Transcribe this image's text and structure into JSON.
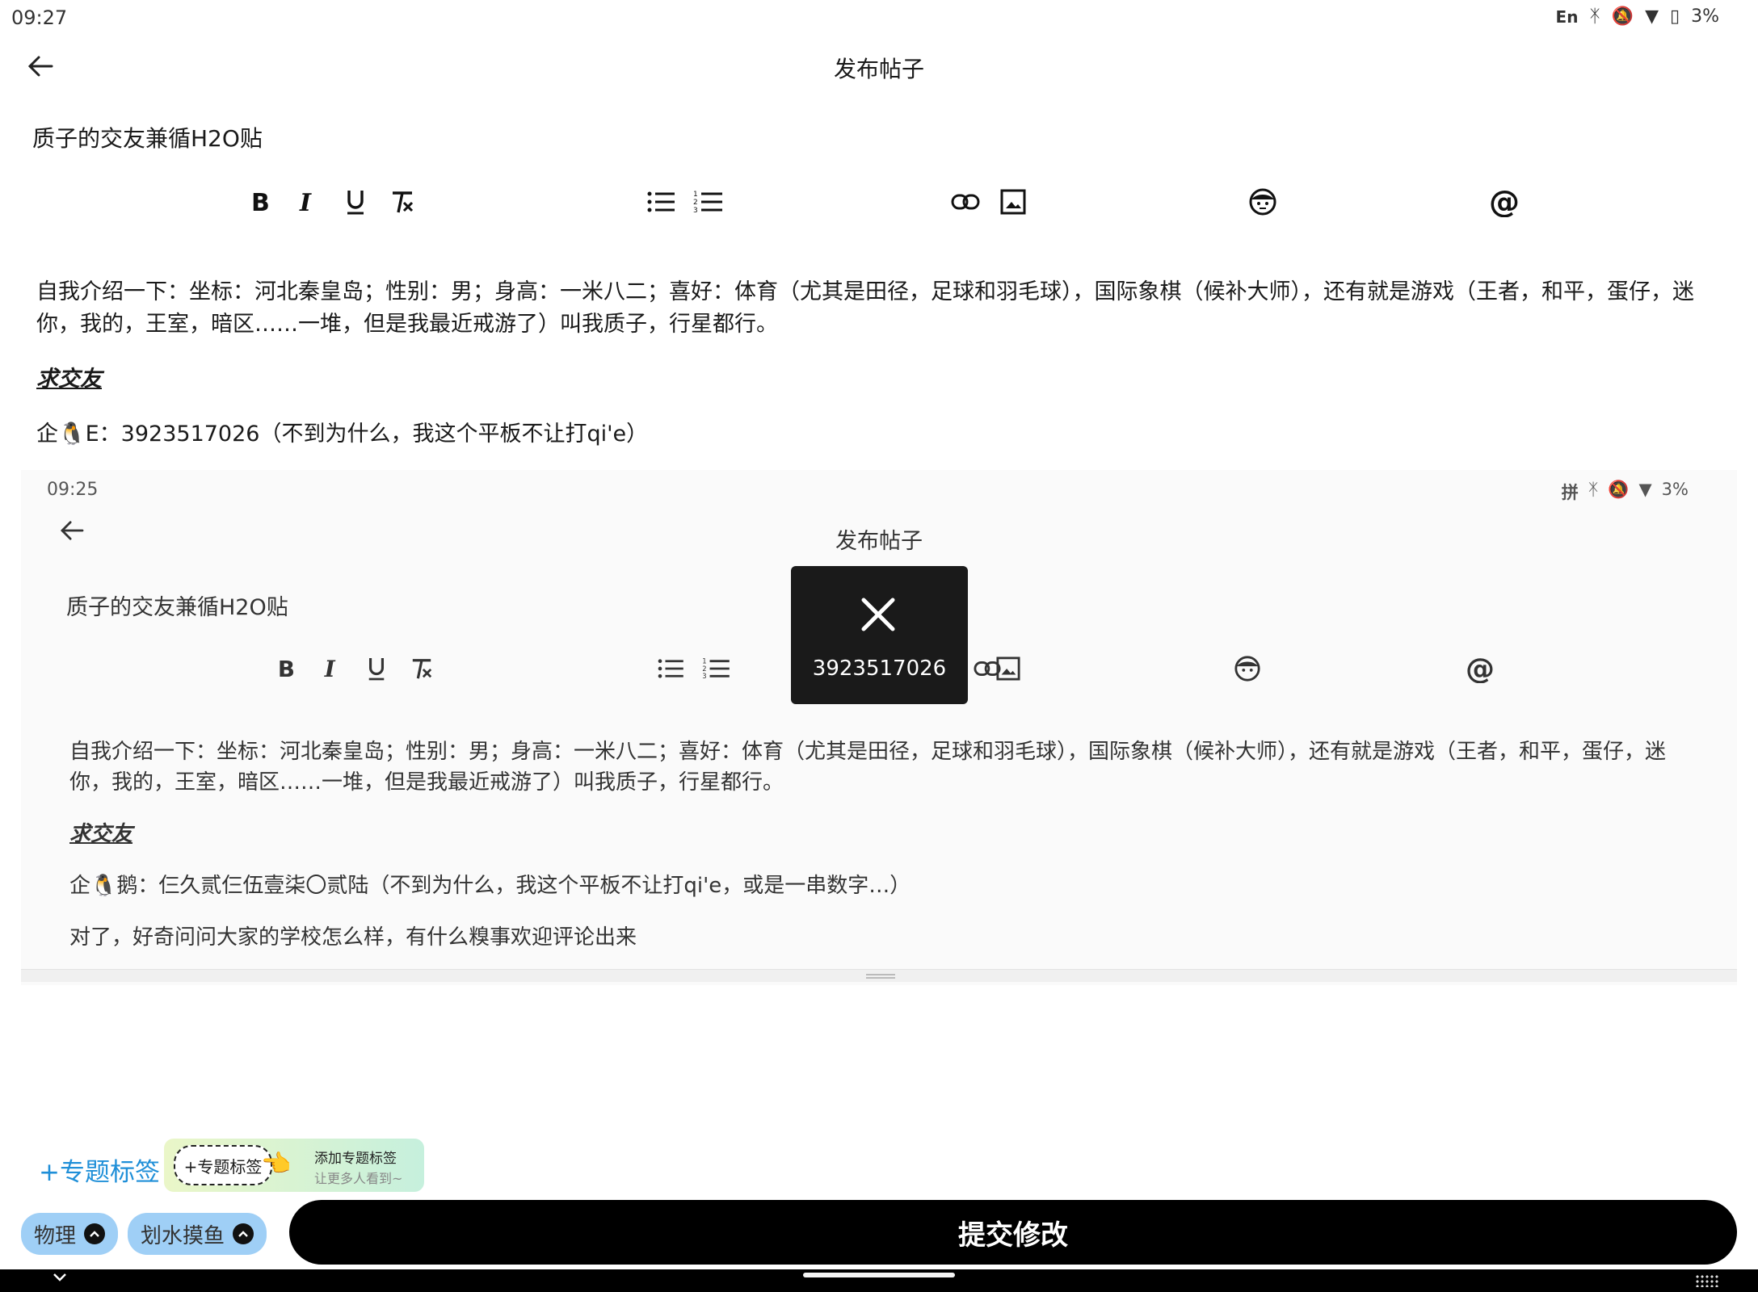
{
  "status_bar": {
    "time": "09:27",
    "input_method": "En",
    "battery": "3%"
  },
  "app_bar": {
    "title": "发布帖子"
  },
  "post": {
    "title": "质子的交友兼循H2O贴",
    "paragraphs": [
      "自我介绍一下：坐标：河北秦皇岛；性别：男；身高：一米八二；喜好：体育（尤其是田径，足球和羽毛球），国际象棋（候补大师），还有就是游戏（王者，和平，蛋仔，迷你，我的，王室，暗区……一堆，但是我最近戒游了）叫我质子，行星都行。",
      "求交友",
      "企🐧E：3923517026（不到为什么，我这个平板不让打qi'e）"
    ]
  },
  "embedded_screenshot": {
    "time": "09:25",
    "input_method": "拼",
    "battery": "3%",
    "title": "发布帖子",
    "post_title": "质子的交友兼循H2O贴",
    "paragraphs": [
      "自我介绍一下：坐标：河北秦皇岛；性别：男；身高：一米八二；喜好：体育（尤其是田径，足球和羽毛球），国际象棋（候补大师），还有就是游戏（王者，和平，蛋仔，迷你，我的，王室，暗区……一堆，但是我最近戒游了）叫我质子，行星都行。",
      "求交友",
      "企🐧鹅：仨久贰仨伍壹柒〇贰陆（不到为什么，我这个平板不让打qi'e，或是一串数字…）",
      "对了，好奇问问大家的学校怎么样，有什么糗事欢迎评论出来"
    ],
    "toast": {
      "text": "3923517026"
    }
  },
  "topic": {
    "add_link": "+专题标签",
    "promo_chip": "+专题标签",
    "promo_line1": "添加专题标签",
    "promo_line2": "让更多人看到~"
  },
  "tags": [
    {
      "label": "物理"
    },
    {
      "label": "划水摸鱼"
    }
  ],
  "submit_label": "提交修改",
  "colors": {
    "accent_link": "#1f8fd8",
    "tag_bg": "#9fcff6",
    "submit_bg": "#000000"
  },
  "toolbar_icons": [
    "bold-icon",
    "italic-icon",
    "underline-icon",
    "clear-format-icon",
    "bullet-list-icon",
    "numbered-list-icon",
    "link-icon",
    "image-icon",
    "emoji-icon",
    "mention-icon"
  ]
}
